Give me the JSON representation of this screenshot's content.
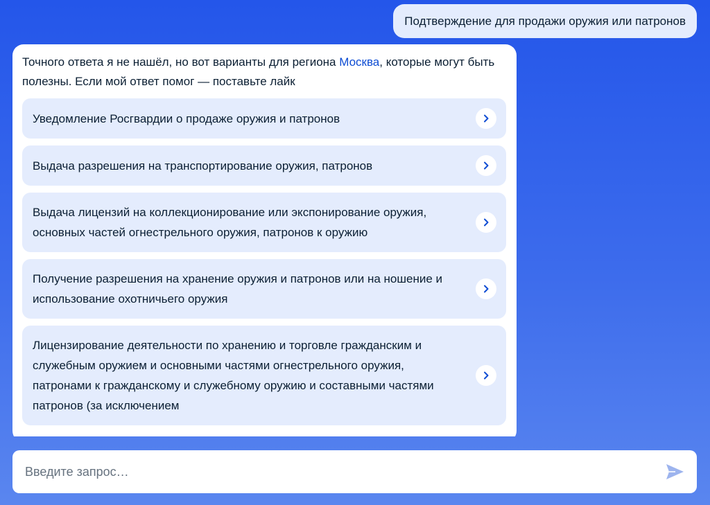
{
  "user_message": "Подтверждение для продажи оружия или патронов",
  "bot": {
    "intro_before": "Точного ответа я не нашёл, но вот варианты для региона ",
    "region": "Москва",
    "intro_after": ", которые могут быть полезны. Если мой ответ помог — поставьте лайк",
    "options": [
      "Уведомление Росгвардии о продаже оружия и патронов",
      "Выдача разрешения на транспортирование оружия, патронов",
      "Выдача лицензий на коллекционирование или экспонирование оружия, основных частей огнестрельного оружия, патронов к оружию",
      "Получение разрешения на хранение оружия и патронов или на ношение и использование охотничьего оружия",
      "Лицензирование деятельности по хранению и торговле гражданским и служебным оружием и основными частями огнестрельного оружия, патронами к гражданскому и служебному оружию и составными частями патронов (за исключением"
    ]
  },
  "input": {
    "placeholder": "Введите запрос…"
  },
  "icons": {
    "option": "chevron-right-icon",
    "send": "send-icon"
  },
  "colors": {
    "accent": "#0d4cd3",
    "bubble": "#e4ecfd",
    "send": "#9db4ee"
  }
}
